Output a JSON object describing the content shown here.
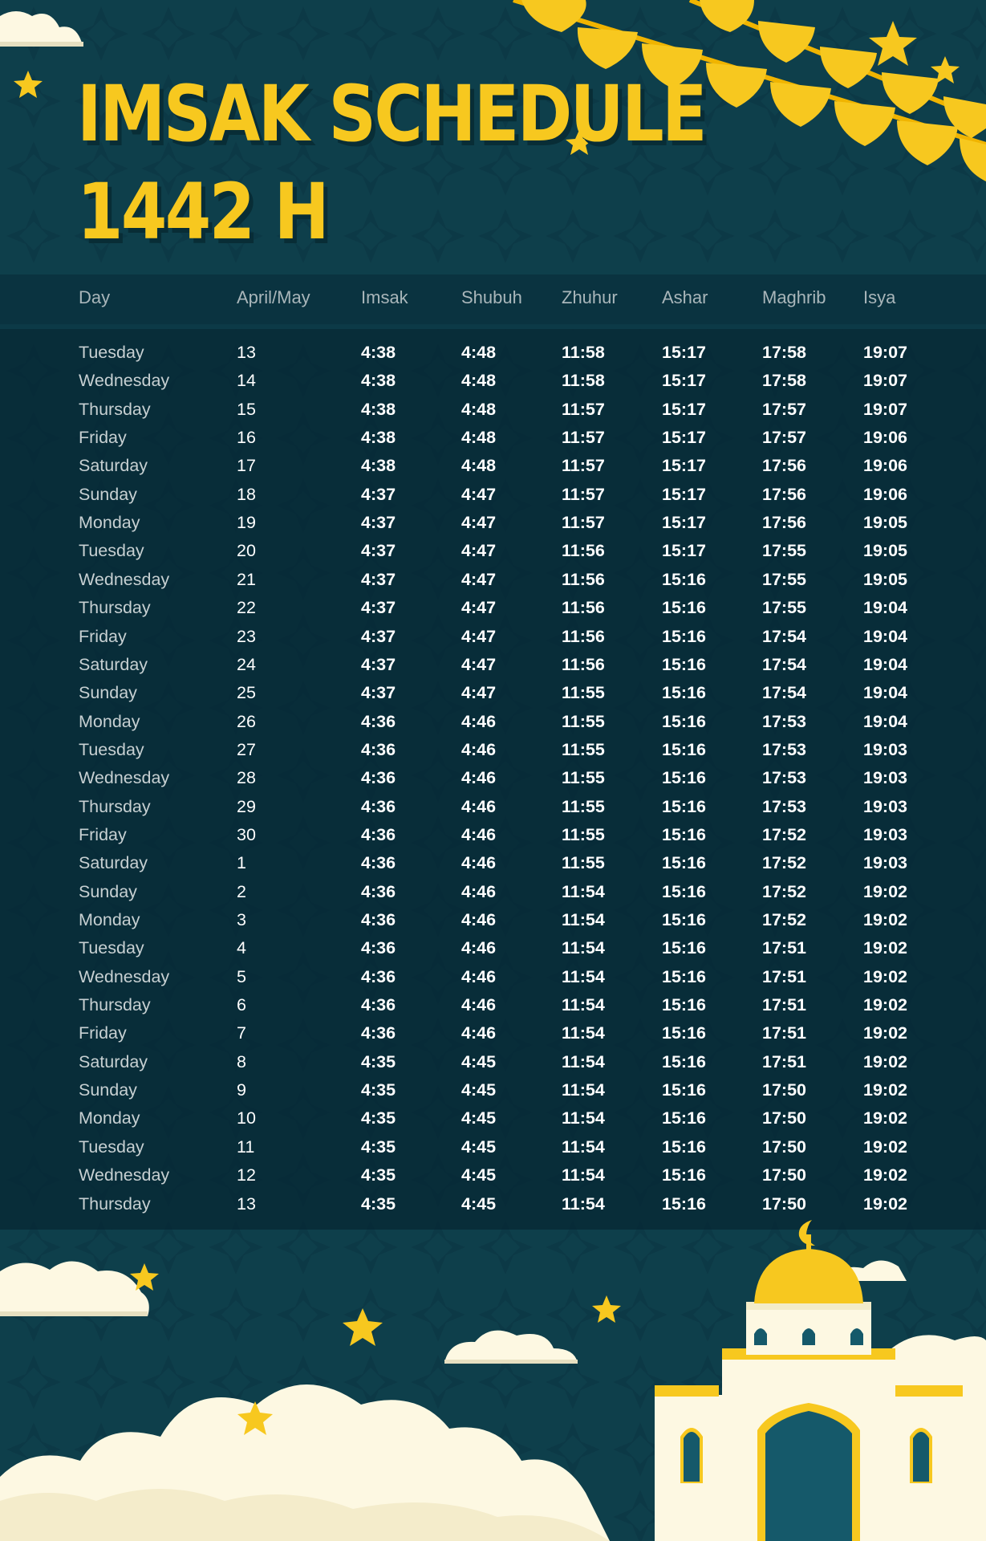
{
  "title": {
    "line1": "IMSAK SCHEDULE",
    "line2": "1442 H"
  },
  "colors": {
    "background": "#0e3f4b",
    "accent": "#f7c81f",
    "table": "#062834"
  },
  "columns": [
    "Day",
    "April/May",
    "Imsak",
    "Shubuh",
    "Zhuhur",
    "Ashar",
    "Maghrib",
    "Isya"
  ],
  "rows": [
    {
      "day": "Tuesday",
      "date": "13",
      "imsak": "4:38",
      "shubuh": "4:48",
      "zhuhur": "11:58",
      "ashar": "15:17",
      "maghrib": "17:58",
      "isya": "19:07"
    },
    {
      "day": "Wednesday",
      "date": "14",
      "imsak": "4:38",
      "shubuh": "4:48",
      "zhuhur": "11:58",
      "ashar": "15:17",
      "maghrib": "17:58",
      "isya": "19:07"
    },
    {
      "day": "Thursday",
      "date": "15",
      "imsak": "4:38",
      "shubuh": "4:48",
      "zhuhur": "11:57",
      "ashar": "15:17",
      "maghrib": "17:57",
      "isya": "19:07"
    },
    {
      "day": "Friday",
      "date": "16",
      "imsak": "4:38",
      "shubuh": "4:48",
      "zhuhur": "11:57",
      "ashar": "15:17",
      "maghrib": "17:57",
      "isya": "19:06"
    },
    {
      "day": "Saturday",
      "date": "17",
      "imsak": "4:38",
      "shubuh": "4:48",
      "zhuhur": "11:57",
      "ashar": "15:17",
      "maghrib": "17:56",
      "isya": "19:06"
    },
    {
      "day": "Sunday",
      "date": "18",
      "imsak": "4:37",
      "shubuh": "4:47",
      "zhuhur": "11:57",
      "ashar": "15:17",
      "maghrib": "17:56",
      "isya": "19:06"
    },
    {
      "day": "Monday",
      "date": "19",
      "imsak": "4:37",
      "shubuh": "4:47",
      "zhuhur": "11:57",
      "ashar": "15:17",
      "maghrib": "17:56",
      "isya": "19:05"
    },
    {
      "day": "Tuesday",
      "date": "20",
      "imsak": "4:37",
      "shubuh": "4:47",
      "zhuhur": "11:56",
      "ashar": "15:17",
      "maghrib": "17:55",
      "isya": "19:05"
    },
    {
      "day": "Wednesday",
      "date": "21",
      "imsak": "4:37",
      "shubuh": "4:47",
      "zhuhur": "11:56",
      "ashar": "15:16",
      "maghrib": "17:55",
      "isya": "19:05"
    },
    {
      "day": "Thursday",
      "date": "22",
      "imsak": "4:37",
      "shubuh": "4:47",
      "zhuhur": "11:56",
      "ashar": "15:16",
      "maghrib": "17:55",
      "isya": "19:04"
    },
    {
      "day": "Friday",
      "date": "23",
      "imsak": "4:37",
      "shubuh": "4:47",
      "zhuhur": "11:56",
      "ashar": "15:16",
      "maghrib": "17:54",
      "isya": "19:04"
    },
    {
      "day": "Saturday",
      "date": "24",
      "imsak": "4:37",
      "shubuh": "4:47",
      "zhuhur": "11:56",
      "ashar": "15:16",
      "maghrib": "17:54",
      "isya": "19:04"
    },
    {
      "day": "Sunday",
      "date": "25",
      "imsak": "4:37",
      "shubuh": "4:47",
      "zhuhur": "11:55",
      "ashar": "15:16",
      "maghrib": "17:54",
      "isya": "19:04"
    },
    {
      "day": "Monday",
      "date": "26",
      "imsak": "4:36",
      "shubuh": "4:46",
      "zhuhur": "11:55",
      "ashar": "15:16",
      "maghrib": "17:53",
      "isya": "19:04"
    },
    {
      "day": "Tuesday",
      "date": "27",
      "imsak": "4:36",
      "shubuh": "4:46",
      "zhuhur": "11:55",
      "ashar": "15:16",
      "maghrib": "17:53",
      "isya": "19:03"
    },
    {
      "day": "Wednesday",
      "date": "28",
      "imsak": "4:36",
      "shubuh": "4:46",
      "zhuhur": "11:55",
      "ashar": "15:16",
      "maghrib": "17:53",
      "isya": "19:03"
    },
    {
      "day": "Thursday",
      "date": "29",
      "imsak": "4:36",
      "shubuh": "4:46",
      "zhuhur": "11:55",
      "ashar": "15:16",
      "maghrib": "17:53",
      "isya": "19:03"
    },
    {
      "day": "Friday",
      "date": "30",
      "imsak": "4:36",
      "shubuh": "4:46",
      "zhuhur": "11:55",
      "ashar": "15:16",
      "maghrib": "17:52",
      "isya": "19:03"
    },
    {
      "day": "Saturday",
      "date": "1",
      "imsak": "4:36",
      "shubuh": "4:46",
      "zhuhur": "11:55",
      "ashar": "15:16",
      "maghrib": "17:52",
      "isya": "19:03"
    },
    {
      "day": "Sunday",
      "date": "2",
      "imsak": "4:36",
      "shubuh": "4:46",
      "zhuhur": "11:54",
      "ashar": "15:16",
      "maghrib": "17:52",
      "isya": "19:02"
    },
    {
      "day": "Monday",
      "date": "3",
      "imsak": "4:36",
      "shubuh": "4:46",
      "zhuhur": "11:54",
      "ashar": "15:16",
      "maghrib": "17:52",
      "isya": "19:02"
    },
    {
      "day": "Tuesday",
      "date": "4",
      "imsak": "4:36",
      "shubuh": "4:46",
      "zhuhur": "11:54",
      "ashar": "15:16",
      "maghrib": "17:51",
      "isya": "19:02"
    },
    {
      "day": "Wednesday",
      "date": "5",
      "imsak": "4:36",
      "shubuh": "4:46",
      "zhuhur": "11:54",
      "ashar": "15:16",
      "maghrib": "17:51",
      "isya": "19:02"
    },
    {
      "day": "Thursday",
      "date": "6",
      "imsak": "4:36",
      "shubuh": "4:46",
      "zhuhur": "11:54",
      "ashar": "15:16",
      "maghrib": "17:51",
      "isya": "19:02"
    },
    {
      "day": "Friday",
      "date": "7",
      "imsak": "4:36",
      "shubuh": "4:46",
      "zhuhur": "11:54",
      "ashar": "15:16",
      "maghrib": "17:51",
      "isya": "19:02"
    },
    {
      "day": "Saturday",
      "date": "8",
      "imsak": "4:35",
      "shubuh": "4:45",
      "zhuhur": "11:54",
      "ashar": "15:16",
      "maghrib": "17:51",
      "isya": "19:02"
    },
    {
      "day": "Sunday",
      "date": "9",
      "imsak": "4:35",
      "shubuh": "4:45",
      "zhuhur": "11:54",
      "ashar": "15:16",
      "maghrib": "17:50",
      "isya": "19:02"
    },
    {
      "day": "Monday",
      "date": "10",
      "imsak": "4:35",
      "shubuh": "4:45",
      "zhuhur": "11:54",
      "ashar": "15:16",
      "maghrib": "17:50",
      "isya": "19:02"
    },
    {
      "day": "Tuesday",
      "date": "11",
      "imsak": "4:35",
      "shubuh": "4:45",
      "zhuhur": "11:54",
      "ashar": "15:16",
      "maghrib": "17:50",
      "isya": "19:02"
    },
    {
      "day": "Wednesday",
      "date": "12",
      "imsak": "4:35",
      "shubuh": "4:45",
      "zhuhur": "11:54",
      "ashar": "15:16",
      "maghrib": "17:50",
      "isya": "19:02"
    },
    {
      "day": "Thursday",
      "date": "13",
      "imsak": "4:35",
      "shubuh": "4:45",
      "zhuhur": "11:54",
      "ashar": "15:16",
      "maghrib": "17:50",
      "isya": "19:02"
    }
  ],
  "icons": [
    "star-icon",
    "cloud-icon",
    "bunting-flags",
    "mosque-illustration",
    "crescent-icon"
  ]
}
